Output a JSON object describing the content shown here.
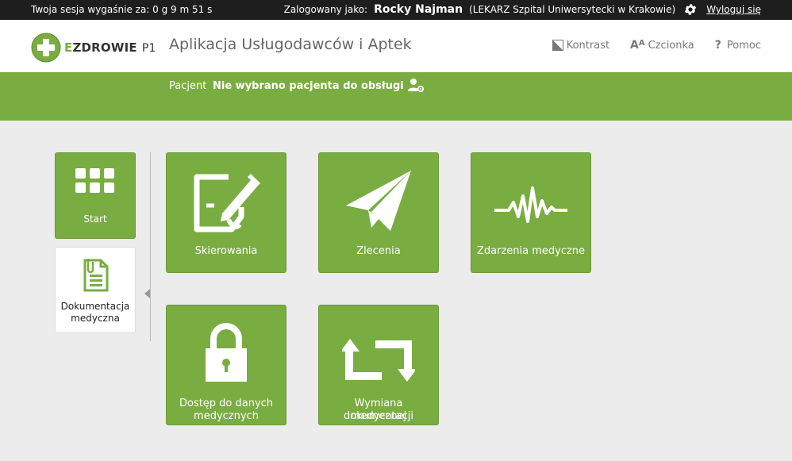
{
  "topbar": {
    "session_text": "Twoja sesja wygaśnie za: 0 g 9 m 51 s",
    "logged_label": "Zalogowany jako:",
    "user_name": "Rocky Najman",
    "user_role": "(LEKARZ Szpital Uniwersytecki w Krakowie)",
    "logout": "Wyloguj się"
  },
  "header": {
    "logo_e": "E",
    "logo_rest": "ZDROWIE",
    "logo_p1": "P1",
    "app_title": "Aplikacja Usługodawców i Aptek",
    "tools": {
      "contrast": "Kontrast",
      "font": "Czcionka",
      "help": "Pomoc"
    }
  },
  "patient": {
    "label": "Pacjent",
    "value": "Nie wybrano pacjenta do obsługi"
  },
  "sidebar": {
    "start": "Start",
    "doc_line1": "Dokumentacja",
    "doc_line2": "medyczna"
  },
  "tiles": {
    "skierowania": "Skierowania",
    "zlecenia": "Zlecenia",
    "zdarzenia": "Zdarzenia medyczne",
    "dostep_line1": "Dostęp do danych",
    "dostep_line2": "medycznych",
    "wymiana_line1": "Wymiana dokumentacji",
    "wymiana_line2": "medycznej"
  },
  "colors": {
    "brand_green": "#7aad41",
    "topbar_bg": "#1e1e1e",
    "page_bg": "#ececec"
  }
}
